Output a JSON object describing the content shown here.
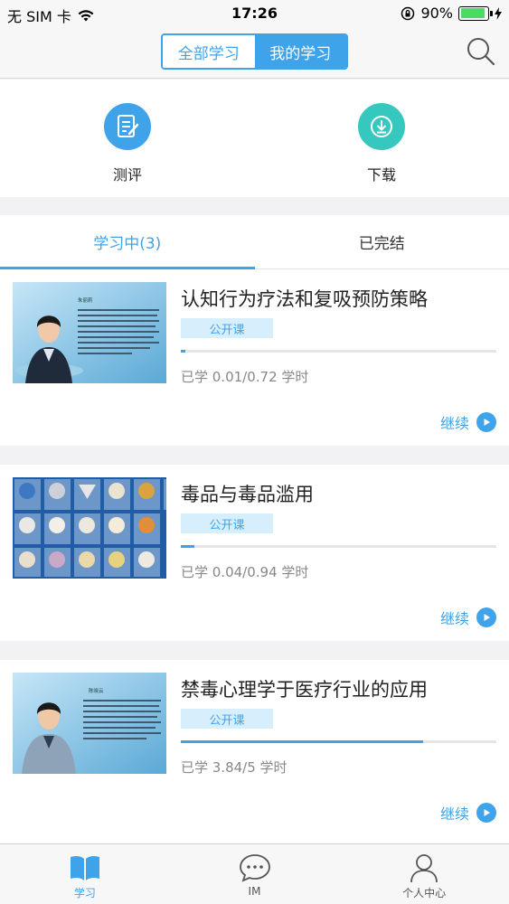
{
  "status_bar": {
    "carrier": "无 SIM 卡",
    "time": "17:26",
    "battery": "90%"
  },
  "nav": {
    "segments": [
      "全部学习",
      "我的学习"
    ],
    "active_segment": 1,
    "search_icon": "search-icon"
  },
  "quick_actions": [
    {
      "label": "测评",
      "icon": "assessment-icon",
      "color": "#3fa3e9"
    },
    {
      "label": "下载",
      "icon": "download-icon",
      "color": "#36c8be"
    }
  ],
  "tabs": [
    {
      "label": "学习中(3)",
      "active": true
    },
    {
      "label": "已完结",
      "active": false
    }
  ],
  "courses": [
    {
      "title": "认知行为疗法和复吸预防策略",
      "badge": "公开课",
      "progress": 0.014,
      "hours": "已学 0.01/0.72 学时",
      "continue_label": "继续",
      "thumb_name": "朱丽莉"
    },
    {
      "title": "毒品与毒品滥用",
      "badge": "公开课",
      "progress": 0.043,
      "hours": "已学 0.04/0.94 学时",
      "continue_label": "继续"
    },
    {
      "title": "禁毒心理学于医疗行业的应用",
      "badge": "公开课",
      "progress": 0.768,
      "hours": "已学 3.84/5 学时",
      "continue_label": "继续",
      "thumb_name": "陈晓云"
    }
  ],
  "tabbar": [
    {
      "label": "学习",
      "icon": "book-icon",
      "active": true
    },
    {
      "label": "IM",
      "icon": "chat-icon",
      "active": false
    },
    {
      "label": "个人中心",
      "icon": "profile-icon",
      "active": false
    }
  ],
  "colors": {
    "accent": "#3fa3e9",
    "teal": "#36c8be"
  }
}
